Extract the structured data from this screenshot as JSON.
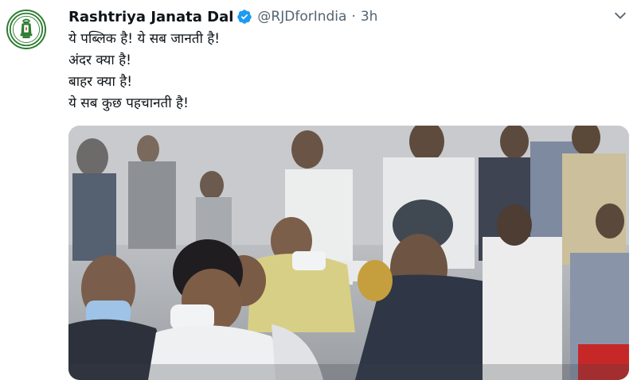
{
  "tweet": {
    "author_name": "Rashtriya Janata Dal",
    "handle": "@RJDforIndia",
    "separator": "·",
    "time": "3h",
    "lines": [
      "ये पब्लिक है! ये सब जानती है!",
      "अंदर क्या है!",
      "बाहर क्या है!",
      "ये सब कुछ पहचानती है!"
    ]
  },
  "icons": {
    "avatar": "lantern-logo",
    "verified": "verified-badge-icon",
    "more": "chevron-down-icon"
  },
  "colors": {
    "verified": "#1d9bf0",
    "secondary_text": "#536471",
    "logo_green": "#2e7d32"
  }
}
